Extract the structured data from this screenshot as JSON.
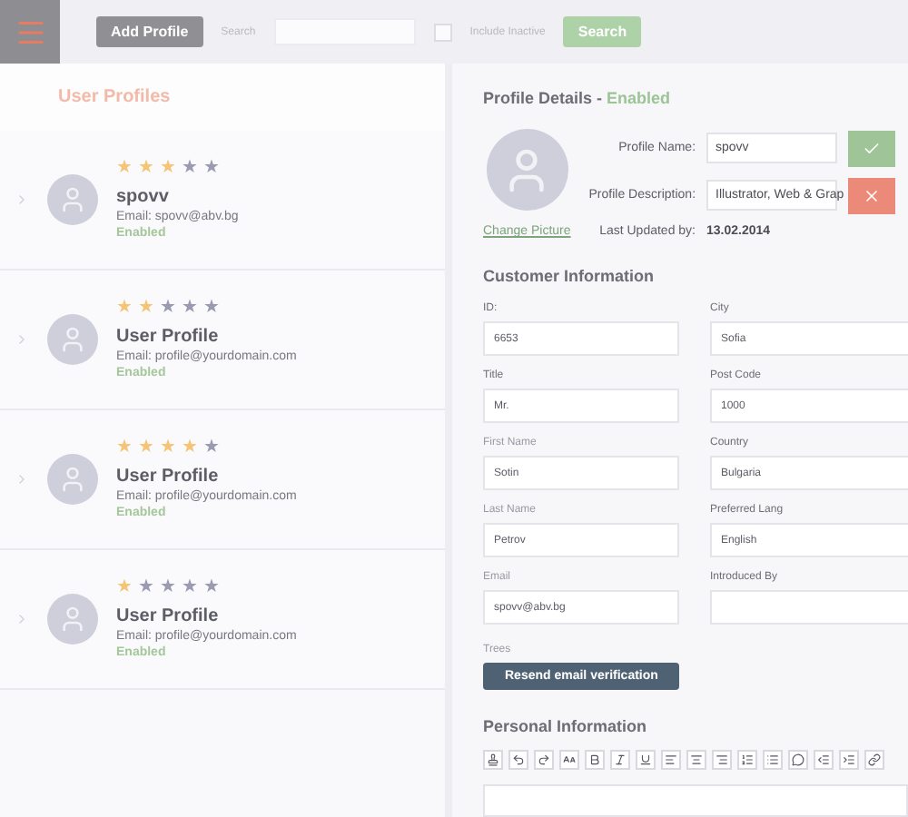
{
  "toolbar": {
    "add_button": "Add Profile",
    "search_label": "Search",
    "include_inactive": {
      "label": "Include Inactive",
      "checked": false
    },
    "search_button": "Search"
  },
  "profiles_panel": {
    "title": "User Profiles",
    "profiles": [
      {
        "name": "spovv",
        "email": "Email: spovv@abv.bg",
        "status": "Enabled",
        "stars": 3
      },
      {
        "name": "User Profile",
        "email": "Email: profile@yourdomain.com",
        "status": "Enabled",
        "stars": 2
      },
      {
        "name": "User Profile",
        "email": "Email: profile@yourdomain.com",
        "status": "Enabled",
        "stars": 4
      },
      {
        "name": "User Profile",
        "email": "Email: profile@yourdomain.com",
        "status": "Enabled",
        "stars": 1
      }
    ]
  },
  "details": {
    "title": "Profile Details - ",
    "status": "Enabled",
    "change_picture": "Change Picture",
    "fields": [
      {
        "label": "Profile Name:",
        "value": "spovv"
      },
      {
        "label": "Profile Description:",
        "value": "Illustrator, Web & Grap"
      }
    ],
    "last_updated": {
      "label": "Last Updated by:",
      "value": "13.02.2014"
    }
  },
  "customer_info": {
    "title": "Customer Information",
    "fields": [
      {
        "label": "ID:",
        "value": "6653",
        "kind": "text"
      },
      {
        "label": "City",
        "value": "Sofia",
        "kind": "text"
      },
      {
        "label": "Title",
        "value": "Mr.",
        "kind": "text"
      },
      {
        "label": "Post Code",
        "value": "1000",
        "kind": "text"
      },
      {
        "label": "First Name",
        "value": "Sotin",
        "kind": "text"
      },
      {
        "label": "Country",
        "value": "Bulgaria",
        "kind": "select"
      },
      {
        "label": "Last Name",
        "value": "Petrov",
        "kind": "text"
      },
      {
        "label": "Preferred Lang",
        "value": "English",
        "kind": "select"
      },
      {
        "label": "Email",
        "value": "spovv@abv.bg",
        "kind": "text"
      },
      {
        "label": "Introduced By",
        "kind": "text"
      }
    ],
    "note": "Trees",
    "resend_button": "Resend email verification"
  },
  "personal_info": {
    "title": "Personal Information"
  }
}
